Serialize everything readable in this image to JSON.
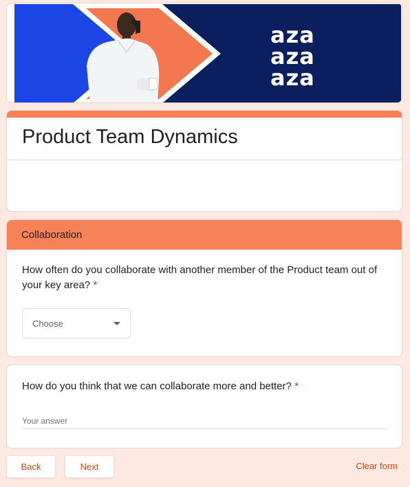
{
  "banner": {
    "brand_lines": [
      "aza",
      "aza",
      "aza"
    ],
    "colors": {
      "blue": "#1b46e5",
      "orange": "#f4784f",
      "navy": "#0b1f5e",
      "white": "#ffffff"
    }
  },
  "form": {
    "title": "Product Team Dynamics",
    "accent_color": "#f97f56"
  },
  "section": {
    "title": "Collaboration",
    "questions": [
      {
        "text": "How often do you collaborate with another member of the Product team out of your key area?",
        "required_mark": "*",
        "input_type": "dropdown",
        "selected_value": "Choose"
      },
      {
        "text": "How do you think that we can collaborate more and better?",
        "required_mark": "*",
        "input_type": "short-answer",
        "placeholder": "Your answer",
        "value": ""
      }
    ]
  },
  "footer": {
    "back_label": "Back",
    "next_label": "Next",
    "clear_label": "Clear form",
    "button_text_color": "#c8481c"
  }
}
